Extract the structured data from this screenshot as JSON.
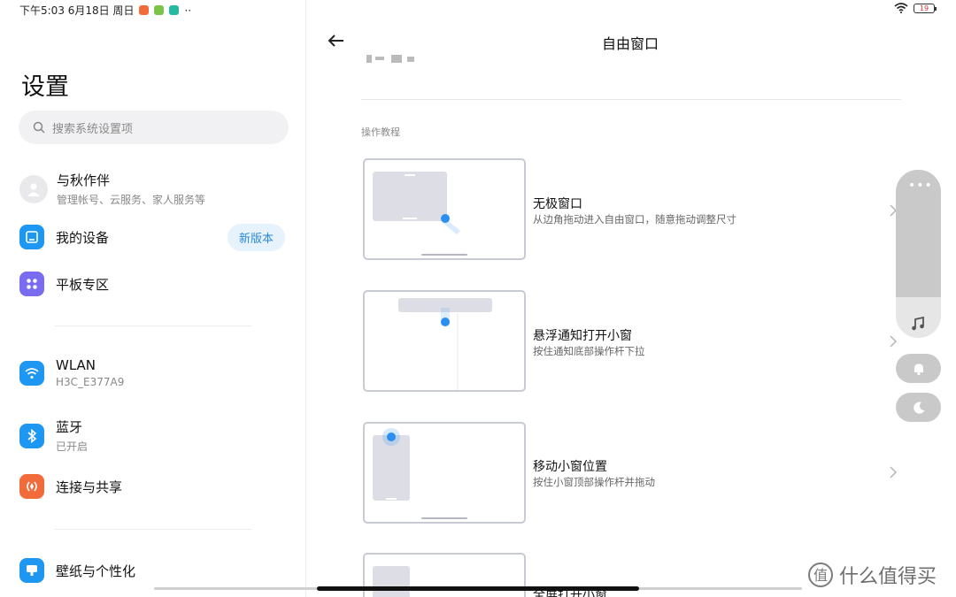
{
  "status_bar": {
    "time_date": "下午5:03 6月18日 周日",
    "overflow": "··",
    "battery": "19",
    "app_colors": [
      "#f26b3a",
      "#7cc34a",
      "#26b8a2"
    ]
  },
  "left": {
    "title": "设置",
    "search_placeholder": "搜索系统设置项",
    "account": {
      "name": "与秋作伴",
      "sub": "管理帐号、云服务、家人服务等"
    },
    "items": [
      {
        "label": "我的设备",
        "badge": "新版本",
        "icon": "device-icon",
        "color": "#1e97f3"
      },
      {
        "label": "平板专区",
        "icon": "grid-icon",
        "color": "#7a6cf0"
      },
      {
        "label": "WLAN",
        "sub": "H3C_E377A9",
        "icon": "wifi-icon",
        "color": "#1e97f3"
      },
      {
        "label": "蓝牙",
        "sub": "已开启",
        "icon": "bluetooth-icon",
        "color": "#1e97f3"
      },
      {
        "label": "连接与共享",
        "icon": "share-icon",
        "color": "#f26b3a"
      },
      {
        "label": "壁纸与个性化",
        "icon": "wallpaper-icon",
        "color": "#1e97f3"
      }
    ]
  },
  "right": {
    "title": "自由窗口",
    "section": "操作教程",
    "tutorials": [
      {
        "title": "无极窗口",
        "sub": "从边角拖动进入自由窗口，随意拖动调整尺寸"
      },
      {
        "title": "悬浮通知打开小窗",
        "sub": "按住通知底部操作杆下拉"
      },
      {
        "title": "移动小窗位置",
        "sub": "按住小窗顶部操作杆并拖动"
      },
      {
        "title": "全屏打开小窗"
      }
    ]
  },
  "watermark": "什么值得买",
  "colors": {
    "accent": "#2b8ff0",
    "card_border": "#c8cad4"
  }
}
